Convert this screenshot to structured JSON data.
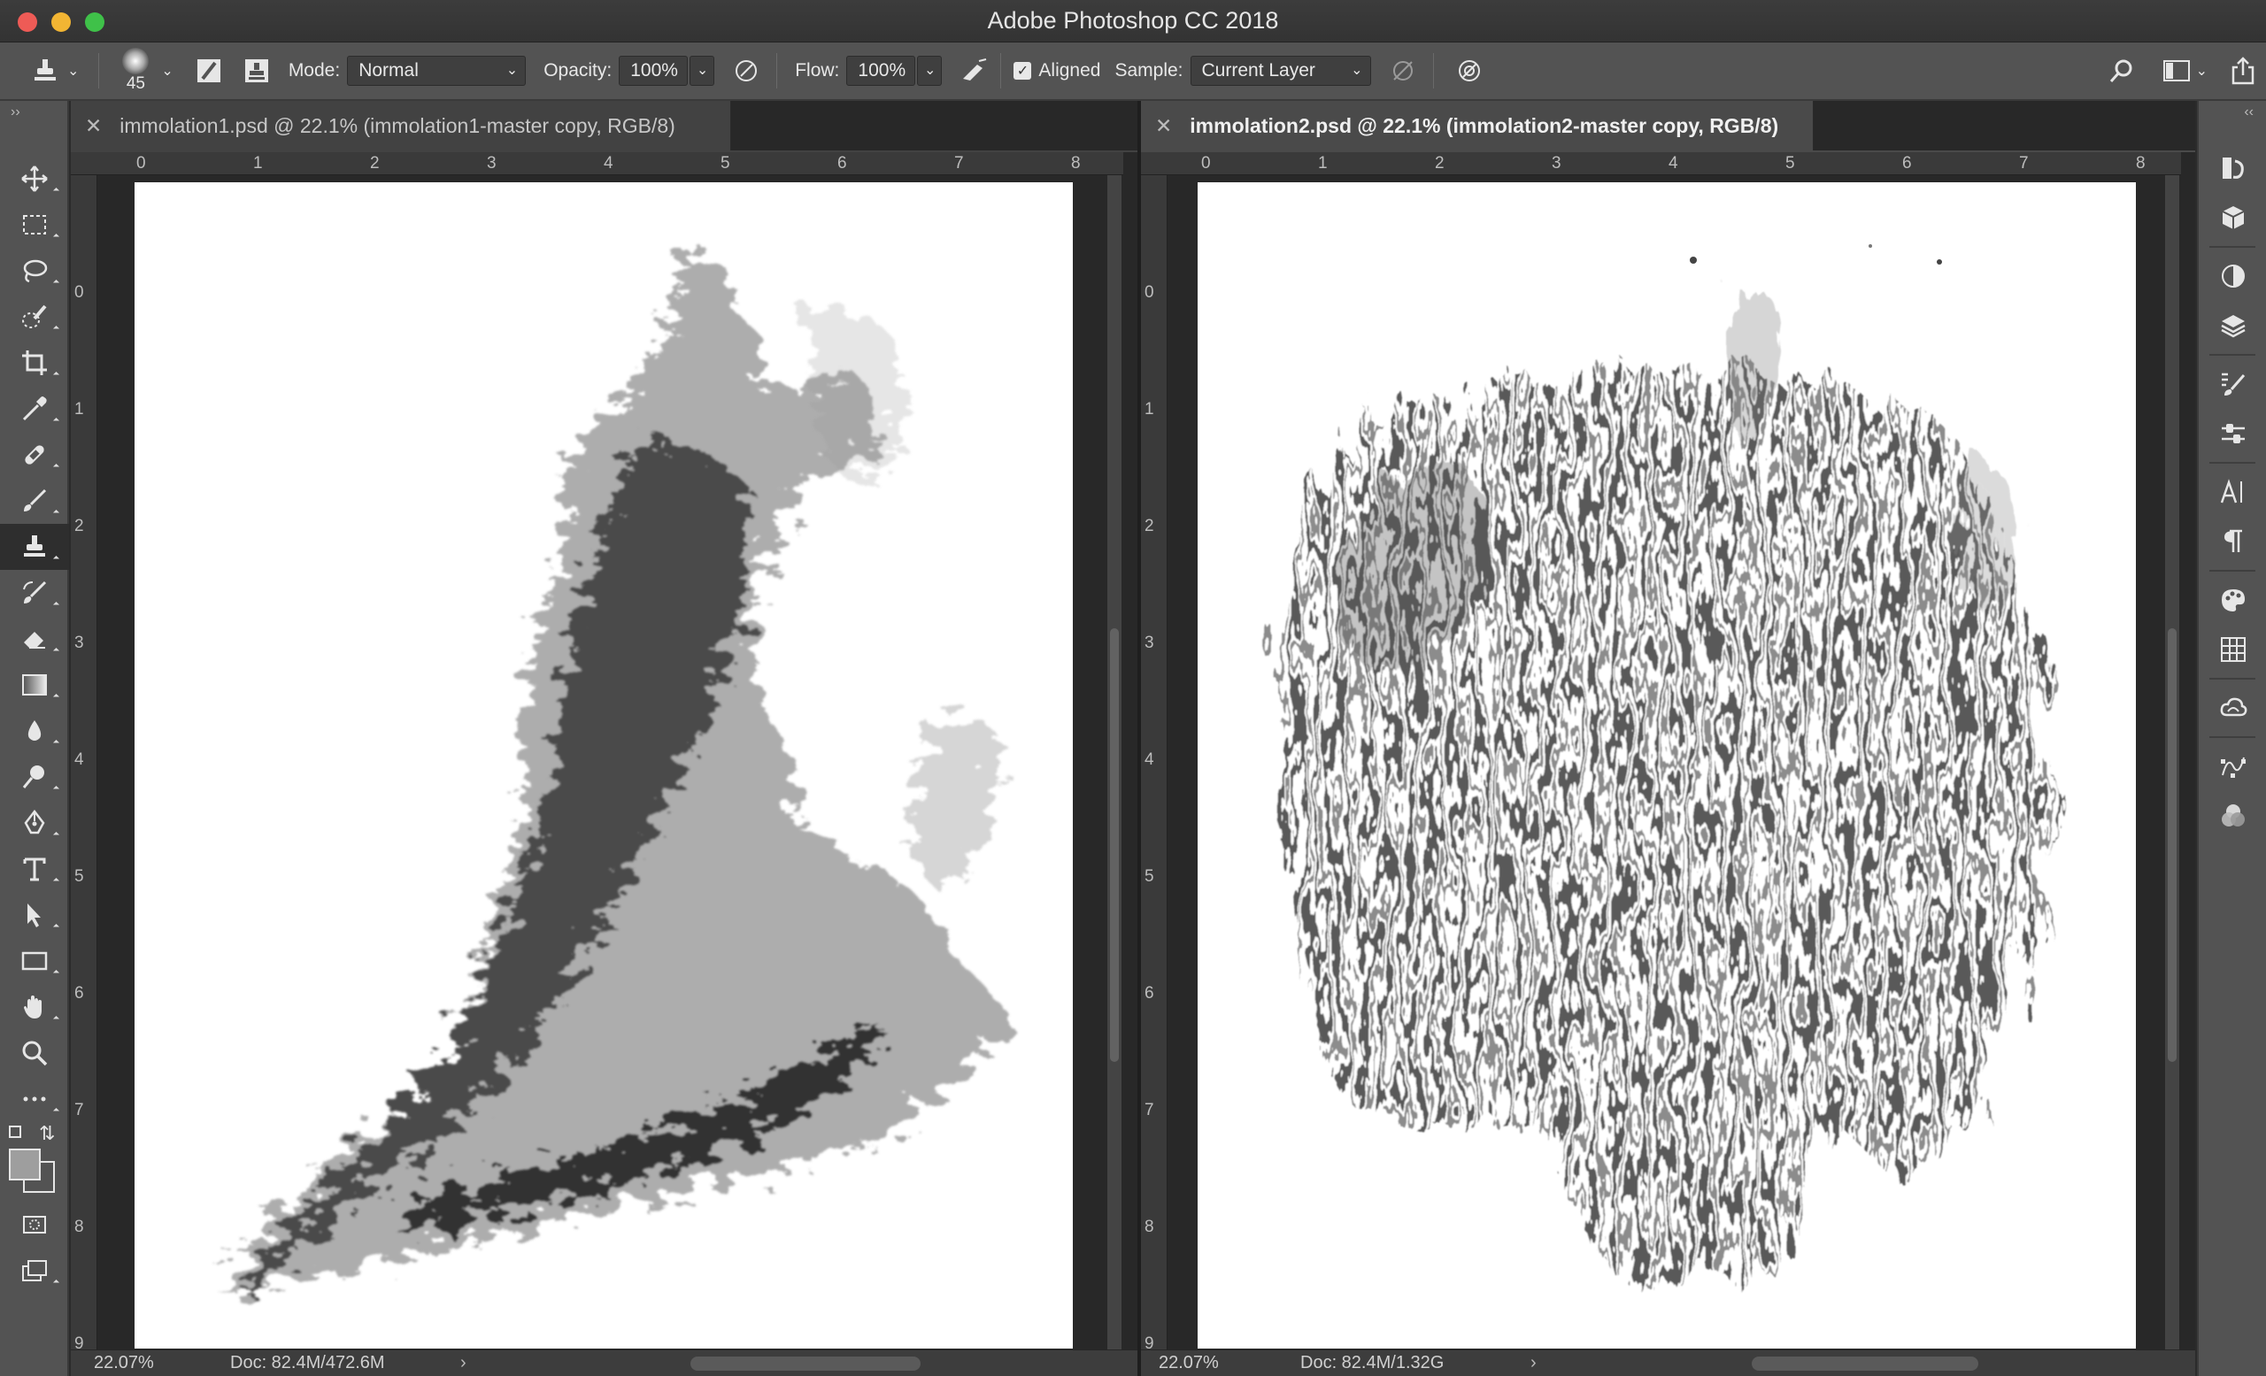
{
  "window": {
    "title": "Adobe Photoshop CC 2018"
  },
  "options": {
    "brush_size": "45",
    "mode_label": "Mode:",
    "mode_value": "Normal",
    "opacity_label": "Opacity:",
    "opacity_value": "100%",
    "flow_label": "Flow:",
    "flow_value": "100%",
    "aligned_label": "Aligned",
    "aligned_checked": true,
    "sample_label": "Sample:",
    "sample_value": "Current Layer"
  },
  "tools": [
    {
      "name": "move-tool",
      "icon": "move-icon"
    },
    {
      "name": "marquee-tool",
      "icon": "rect-marquee-icon"
    },
    {
      "name": "lasso-tool",
      "icon": "lasso-icon"
    },
    {
      "name": "quick-select-tool",
      "icon": "quick-select-icon"
    },
    {
      "name": "crop-tool",
      "icon": "crop-icon"
    },
    {
      "name": "eyedropper-tool",
      "icon": "eyedropper-icon"
    },
    {
      "name": "healing-tool",
      "icon": "bandage-icon"
    },
    {
      "name": "brush-tool",
      "icon": "brush-icon"
    },
    {
      "name": "clone-stamp-tool",
      "icon": "stamp-icon",
      "active": true
    },
    {
      "name": "history-brush-tool",
      "icon": "history-brush-icon"
    },
    {
      "name": "eraser-tool",
      "icon": "eraser-icon"
    },
    {
      "name": "gradient-tool",
      "icon": "gradient-icon"
    },
    {
      "name": "blur-tool",
      "icon": "droplet-icon"
    },
    {
      "name": "dodge-tool",
      "icon": "dodge-icon"
    },
    {
      "name": "pen-tool",
      "icon": "pen-icon"
    },
    {
      "name": "type-tool",
      "icon": "type-icon"
    },
    {
      "name": "path-select-tool",
      "icon": "arrow-icon"
    },
    {
      "name": "shape-tool",
      "icon": "rectangle-icon"
    },
    {
      "name": "hand-tool",
      "icon": "hand-icon"
    },
    {
      "name": "zoom-tool",
      "icon": "magnifier-icon"
    },
    {
      "name": "more-tools",
      "icon": "ellipsis-icon"
    }
  ],
  "documents": [
    {
      "tab_label": "immolation1.psd @ 22.1% (immolation1-master copy, RGB/8)",
      "active": false,
      "zoom": "22.07%",
      "doc_info": "Doc: 82.4M/472.6M",
      "ruler_h": [
        "0",
        "1",
        "2",
        "3",
        "4",
        "5",
        "6",
        "7",
        "8"
      ],
      "ruler_v": [
        "0",
        "1",
        "2",
        "3",
        "4",
        "5",
        "6",
        "7",
        "8",
        "9"
      ]
    },
    {
      "tab_label": "immolation2.psd @ 22.1% (immolation2-master copy, RGB/8)",
      "active": true,
      "zoom": "22.07%",
      "doc_info": "Doc: 82.4M/1.32G",
      "ruler_h": [
        "0",
        "1",
        "2",
        "3",
        "4",
        "5",
        "6",
        "7",
        "8"
      ],
      "ruler_v": [
        "0",
        "1",
        "2",
        "3",
        "4",
        "5",
        "6",
        "7",
        "8",
        "9"
      ]
    }
  ],
  "dock": [
    "history-icon",
    "3d-icon",
    "adjustments-icon",
    "layers-icon",
    "brush-settings-icon",
    "brush-presets-icon",
    "character-icon",
    "paragraph-icon",
    "swatches-icon",
    "grid-icon",
    "libraries-icon",
    "paths-icon",
    "channels-icon"
  ]
}
